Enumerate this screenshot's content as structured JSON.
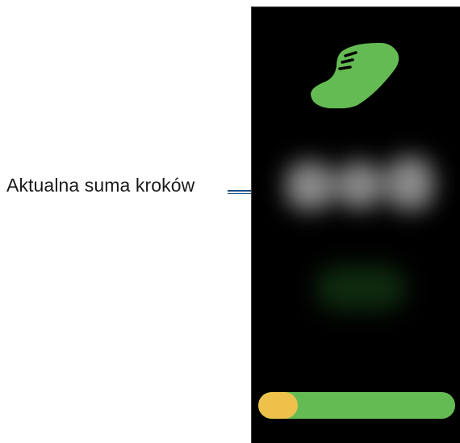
{
  "callout": {
    "label": "Aktualna suma kroków"
  },
  "screen": {
    "icon": "running-shoe-icon",
    "step_count": "",
    "step_goal": ""
  },
  "progress": {
    "fraction": 0.2
  },
  "colors": {
    "screen_background": "#000000",
    "shoe_icon": "#65bb53",
    "progress_track": "#65bb53",
    "progress_fill": "#eec24a",
    "callout_line": "#1b4f86",
    "callout_text": "#1a1a1a"
  }
}
